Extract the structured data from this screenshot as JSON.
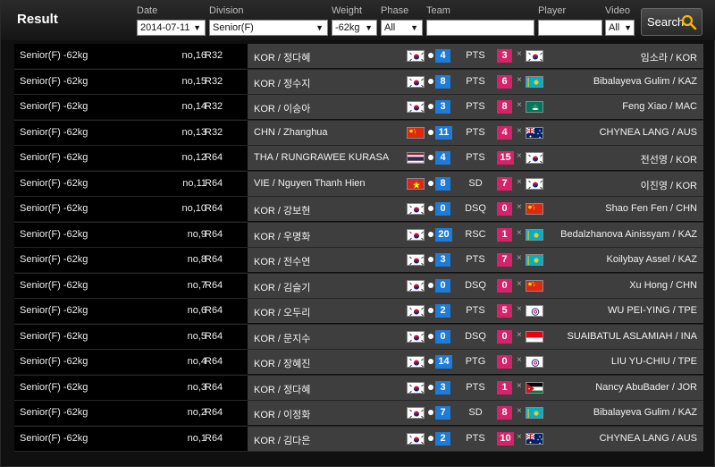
{
  "title": "Result",
  "filters": {
    "date": {
      "label": "Date",
      "value": "2014-07-11"
    },
    "division": {
      "label": "Division",
      "value": "Senior(F)"
    },
    "weight": {
      "label": "Weight",
      "value": "-62kg"
    },
    "phase": {
      "label": "Phase",
      "value": "All"
    },
    "team": {
      "label": "Team",
      "value": ""
    },
    "player": {
      "label": "Player",
      "value": ""
    },
    "video": {
      "label": "Video",
      "value": "All"
    },
    "search_label": "Search"
  },
  "colors": {
    "blue_score": "#1e7bd8",
    "red_score": "#d6226b"
  },
  "rows": [
    {
      "division": "Senior(F) -62kg",
      "no": "no,16",
      "round": "R32",
      "player1": "KOR / 정다혜",
      "flag1": "kor",
      "score1": "4",
      "decision": "PTS",
      "score2": "3",
      "flag2": "kor",
      "player2": "임소라 / KOR"
    },
    {
      "division": "Senior(F) -62kg",
      "no": "no,15",
      "round": "R32",
      "player1": "KOR / 정수지",
      "flag1": "kor",
      "score1": "8",
      "decision": "PTS",
      "score2": "6",
      "flag2": "kaz",
      "player2": "Bibalayeva Gulim / KAZ"
    },
    {
      "division": "Senior(F) -62kg",
      "no": "no,14",
      "round": "R32",
      "player1": "KOR / 이승아",
      "flag1": "kor",
      "score1": "3",
      "decision": "PTS",
      "score2": "8",
      "flag2": "mac",
      "player2": "Feng Xiao / MAC"
    },
    {
      "division": "Senior(F) -62kg",
      "no": "no,13",
      "round": "R32",
      "player1": "CHN / Zhanghua",
      "flag1": "chn",
      "score1": "11",
      "decision": "PTS",
      "score2": "4",
      "flag2": "aus",
      "player2": "CHYNEA LANG / AUS"
    },
    {
      "division": "Senior(F) -62kg",
      "no": "no,12",
      "round": "R64",
      "player1": "THA / RUNGRAWEE KURASA",
      "flag1": "tha",
      "score1": "4",
      "decision": "PTS",
      "score2": "15",
      "flag2": "kor",
      "player2": "전선영 / KOR"
    },
    {
      "division": "Senior(F) -62kg",
      "no": "no,11",
      "round": "R64",
      "player1": "VIE / Nguyen Thanh Hien",
      "flag1": "vie",
      "score1": "8",
      "decision": "SD",
      "score2": "7",
      "flag2": "kor",
      "player2": "이진영 / KOR"
    },
    {
      "division": "Senior(F) -62kg",
      "no": "no,10",
      "round": "R64",
      "player1": "KOR / 강보현",
      "flag1": "kor",
      "score1": "0",
      "decision": "DSQ",
      "score2": "0",
      "flag2": "chn",
      "player2": "Shao Fen Fen / CHN"
    },
    {
      "division": "Senior(F) -62kg",
      "no": "no,9",
      "round": "R64",
      "player1": "KOR / 우명화",
      "flag1": "kor",
      "score1": "20",
      "decision": "RSC",
      "score2": "1",
      "flag2": "kaz",
      "player2": "Bedalzhanova Ainissyam / KAZ"
    },
    {
      "division": "Senior(F) -62kg",
      "no": "no,8",
      "round": "R64",
      "player1": "KOR / 전수연",
      "flag1": "kor",
      "score1": "3",
      "decision": "PTS",
      "score2": "7",
      "flag2": "kaz",
      "player2": "Koilybay Assel / KAZ"
    },
    {
      "division": "Senior(F) -62kg",
      "no": "no,7",
      "round": "R64",
      "player1": "KOR / 김슬기",
      "flag1": "kor",
      "score1": "0",
      "decision": "DSQ",
      "score2": "0",
      "flag2": "chn",
      "player2": "Xu Hong / CHN"
    },
    {
      "division": "Senior(F) -62kg",
      "no": "no,6",
      "round": "R64",
      "player1": "KOR / 오두리",
      "flag1": "kor",
      "score1": "2",
      "decision": "PTS",
      "score2": "5",
      "flag2": "tpe",
      "player2": "WU PEI-YING / TPE"
    },
    {
      "division": "Senior(F) -62kg",
      "no": "no,5",
      "round": "R64",
      "player1": "KOR / 문지수",
      "flag1": "kor",
      "score1": "0",
      "decision": "DSQ",
      "score2": "0",
      "flag2": "ina",
      "player2": "SUAIBATUL ASLAMIAH / INA"
    },
    {
      "division": "Senior(F) -62kg",
      "no": "no,4",
      "round": "R64",
      "player1": "KOR / 장혜진",
      "flag1": "kor",
      "score1": "14",
      "decision": "PTG",
      "score2": "0",
      "flag2": "tpe",
      "player2": "LIU YU-CHIU / TPE"
    },
    {
      "division": "Senior(F) -62kg",
      "no": "no,3",
      "round": "R64",
      "player1": "KOR / 정다혜",
      "flag1": "kor",
      "score1": "3",
      "decision": "PTS",
      "score2": "1",
      "flag2": "jor",
      "player2": "Nancy AbuBader / JOR"
    },
    {
      "division": "Senior(F) -62kg",
      "no": "no,2",
      "round": "R64",
      "player1": "KOR / 이정화",
      "flag1": "kor",
      "score1": "7",
      "decision": "SD",
      "score2": "8",
      "flag2": "kaz",
      "player2": "Bibalayeva Gulim / KAZ"
    },
    {
      "division": "Senior(F) -62kg",
      "no": "no,1",
      "round": "R64",
      "player1": "KOR / 김다은",
      "flag1": "kor",
      "score1": "2",
      "decision": "PTS",
      "score2": "10",
      "flag2": "aus",
      "player2": "CHYNEA LANG / AUS"
    }
  ]
}
